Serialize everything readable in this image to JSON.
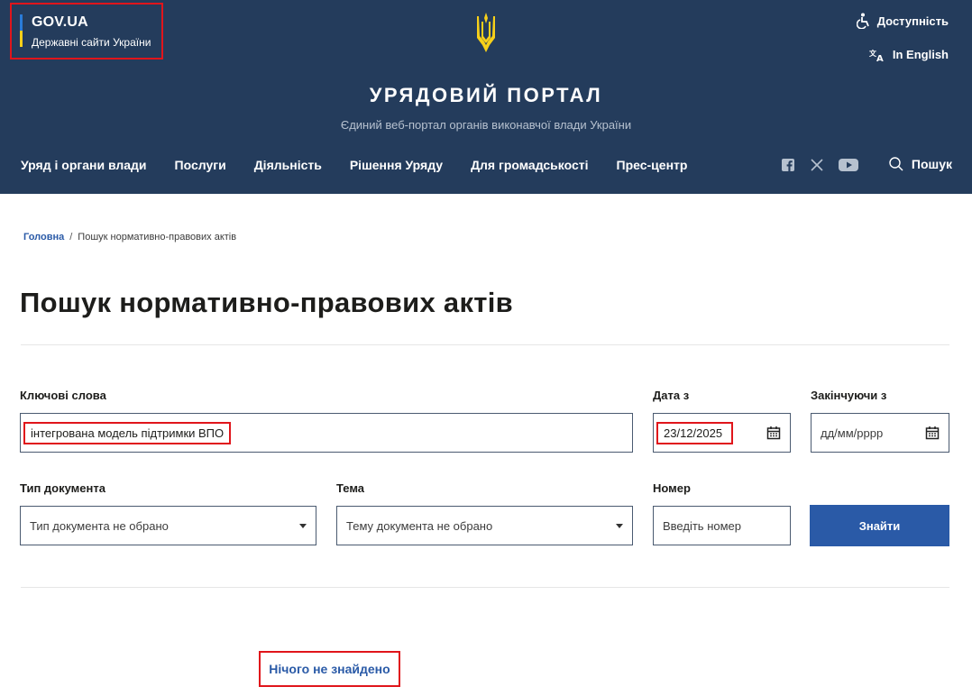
{
  "header": {
    "gov_title": "GOV.UA",
    "gov_subtitle": "Державні сайти України",
    "accessibility_label": "Доступність",
    "english_label": "In English",
    "portal_title": "УРЯДОВИЙ ПОРТАЛ",
    "portal_subtitle": "Єдиний веб-портал органів виконавчої влади України",
    "search_label": "Пошук",
    "nav": [
      {
        "label": "Уряд і органи влади"
      },
      {
        "label": "Послуги"
      },
      {
        "label": "Діяльність"
      },
      {
        "label": "Рішення Уряду"
      },
      {
        "label": "Для громадськості"
      },
      {
        "label": "Прес-центр"
      }
    ],
    "socials": [
      "facebook-icon",
      "x-icon",
      "youtube-icon"
    ],
    "colors": {
      "background": "#243c5c",
      "flag_blue": "#2a7bd8",
      "flag_yellow": "#f7d01a"
    }
  },
  "breadcrumb": {
    "home": "Головна",
    "separator": "/",
    "current": "Пошук нормативно-правових актів"
  },
  "page": {
    "title": "Пошук нормативно-правових актів"
  },
  "form": {
    "keywords_label": "Ключові слова",
    "keywords_value": "інтегрована модель підтримки ВПО",
    "date_from_label": "Дата з",
    "date_from_value": "23/12/2025",
    "date_to_label": "Закінчуючи з",
    "date_to_placeholder": "дд/мм/рррр",
    "doc_type_label": "Тип документа",
    "doc_type_value": "Тип документа не обрано",
    "topic_label": "Тема",
    "topic_value": "Тему документа не обрано",
    "number_label": "Номер",
    "number_placeholder": "Введіть номер",
    "submit_label": "Знайти"
  },
  "result": {
    "message": "Нічого не знайдено"
  },
  "colors": {
    "accent": "#2a5aa7",
    "highlight": "#e0151b"
  }
}
